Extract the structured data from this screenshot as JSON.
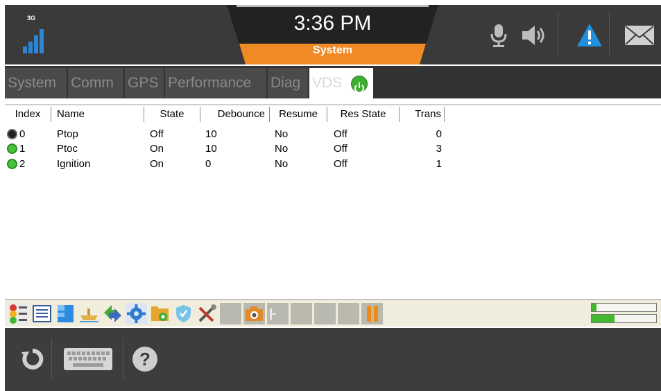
{
  "status": {
    "network": "3G",
    "signal_bars": 4,
    "time": "3:36 PM",
    "context": "System",
    "icons": [
      "microphone-icon",
      "speaker-icon",
      "warning-icon",
      "mail-icon"
    ],
    "colors": {
      "accent": "#f08a24",
      "alert": "#1f8fe0"
    }
  },
  "tabs": [
    {
      "label": "System",
      "active": false
    },
    {
      "label": "Comm",
      "active": false
    },
    {
      "label": "GPS",
      "active": false
    },
    {
      "label": "Performance",
      "active": false
    },
    {
      "label": "Diag",
      "active": false
    },
    {
      "label": "VDS",
      "active": true,
      "icon": "power-icon"
    }
  ],
  "table": {
    "columns": [
      "Index",
      "Name",
      "State",
      "Debounce",
      "Resume",
      "Res State",
      "Trans"
    ],
    "rows": [
      {
        "led": "off",
        "index": "0",
        "name": "Ptop",
        "state": "Off",
        "debounce": "10",
        "resume": "No",
        "res_state": "Off",
        "trans": "0"
      },
      {
        "led": "on",
        "index": "1",
        "name": "Ptoc",
        "state": "On",
        "debounce": "10",
        "resume": "No",
        "res_state": "Off",
        "trans": "3"
      },
      {
        "led": "on",
        "index": "2",
        "name": "Ignition",
        "state": "On",
        "debounce": "0",
        "resume": "No",
        "res_state": "Off",
        "trans": "1"
      }
    ]
  },
  "toolbar": {
    "tools": [
      "status-lights-icon",
      "list-icon",
      "grid-icon",
      "ship-icon",
      "transfer-icon",
      "settings-icon",
      "photo-folder-icon",
      "shield-icon",
      "tools-icon",
      "blank",
      "camera-icon",
      "document-icon",
      "blank",
      "blank",
      "pause-icon"
    ],
    "meter_levels": [
      0.08,
      0.35
    ]
  },
  "footer": {
    "icons": [
      "refresh-icon",
      "keyboard-icon",
      "help-icon"
    ],
    "help_glyph": "?"
  }
}
